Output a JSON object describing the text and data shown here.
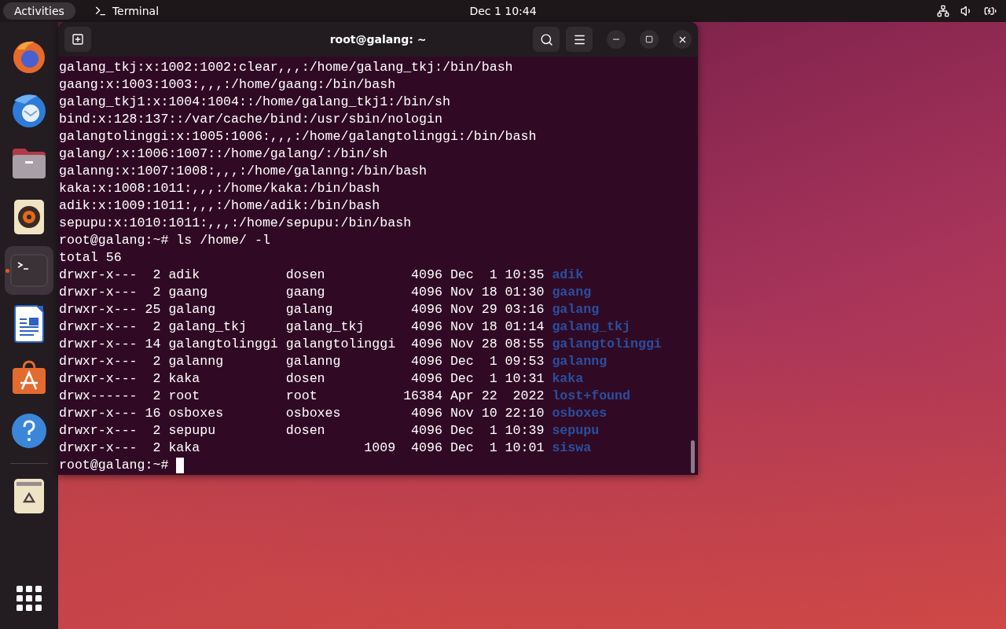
{
  "top_bar": {
    "activities": "Activities",
    "app_menu": "Terminal",
    "clock": "Dec 1  10:44"
  },
  "dock": [
    {
      "kind": "browser",
      "selected": false,
      "running": false
    },
    {
      "kind": "mail",
      "selected": false,
      "running": false
    },
    {
      "kind": "files",
      "selected": false,
      "running": false
    },
    {
      "kind": "music",
      "selected": false,
      "running": false
    },
    {
      "kind": "terminal",
      "selected": true,
      "running": true
    },
    {
      "kind": "writer",
      "selected": false,
      "running": false
    },
    {
      "kind": "store",
      "selected": false,
      "running": false
    },
    {
      "kind": "help",
      "selected": false,
      "running": false
    },
    {
      "kind": "trash",
      "selected": false,
      "running": false
    }
  ],
  "terminal": {
    "title": "root@galang: ~",
    "lines": [
      {
        "kind": "output",
        "text": "galang_tkj:x:1002:1002:clear,,,:/home/galang_tkj:/bin/bash"
      },
      {
        "kind": "output",
        "text": "gaang:x:1003:1003:,,,:/home/gaang:/bin/bash"
      },
      {
        "kind": "output",
        "text": "galang_tkj1:x:1004:1004::/home/galang_tkj1:/bin/sh"
      },
      {
        "kind": "output",
        "text": "bind:x:128:137::/var/cache/bind:/usr/sbin/nologin"
      },
      {
        "kind": "output",
        "text": "galangtolinggi:x:1005:1006:,,,:/home/galangtolinggi:/bin/bash"
      },
      {
        "kind": "output",
        "text": "galang/:x:1006:1007::/home/galang/:/bin/sh"
      },
      {
        "kind": "output",
        "text": "galanng:x:1007:1008:,,,:/home/galanng:/bin/bash"
      },
      {
        "kind": "output",
        "text": "kaka:x:1008:1011:,,,:/home/kaka:/bin/bash"
      },
      {
        "kind": "output",
        "text": "adik:x:1009:1011:,,,:/home/adik:/bin/bash"
      },
      {
        "kind": "output",
        "text": "sepupu:x:1010:1011:,,,:/home/sepupu:/bin/bash"
      },
      {
        "kind": "command",
        "text": "root@galang:~# ls /home/ -l"
      },
      {
        "kind": "output",
        "text": "total 56"
      },
      {
        "kind": "listing",
        "text": "drwxr-x---  2 adik           dosen           4096 Dec  1 10:35",
        "name": "adik"
      },
      {
        "kind": "listing",
        "text": "drwxr-x---  2 gaang          gaang           4096 Nov 18 01:30",
        "name": "gaang"
      },
      {
        "kind": "listing",
        "text": "drwxr-x--- 25 galang         galang          4096 Nov 29 03:16",
        "name": "galang"
      },
      {
        "kind": "listing",
        "text": "drwxr-x---  2 galang_tkj     galang_tkj      4096 Nov 18 01:14",
        "name": "galang_tkj"
      },
      {
        "kind": "listing",
        "text": "drwxr-x--- 14 galangtolinggi galangtolinggi  4096 Nov 28 08:55",
        "name": "galangtolinggi"
      },
      {
        "kind": "listing",
        "text": "drwxr-x---  2 galanng        galanng         4096 Dec  1 09:53",
        "name": "galanng"
      },
      {
        "kind": "listing",
        "text": "drwxr-x---  2 kaka           dosen           4096 Dec  1 10:31",
        "name": "kaka"
      },
      {
        "kind": "listing",
        "text": "drwx------  2 root           root           16384 Apr 22  2022",
        "name": "lost+found"
      },
      {
        "kind": "listing",
        "text": "drwxr-x--- 16 osboxes        osboxes         4096 Nov 10 22:10",
        "name": "osboxes"
      },
      {
        "kind": "listing",
        "text": "drwxr-x---  2 sepupu         dosen           4096 Dec  1 10:39",
        "name": "sepupu"
      },
      {
        "kind": "listing",
        "text": "drwxr-x---  2 kaka                     1009  4096 Dec  1 10:01",
        "name": "siswa"
      },
      {
        "kind": "prompt",
        "text": "root@galang:~#"
      }
    ]
  }
}
